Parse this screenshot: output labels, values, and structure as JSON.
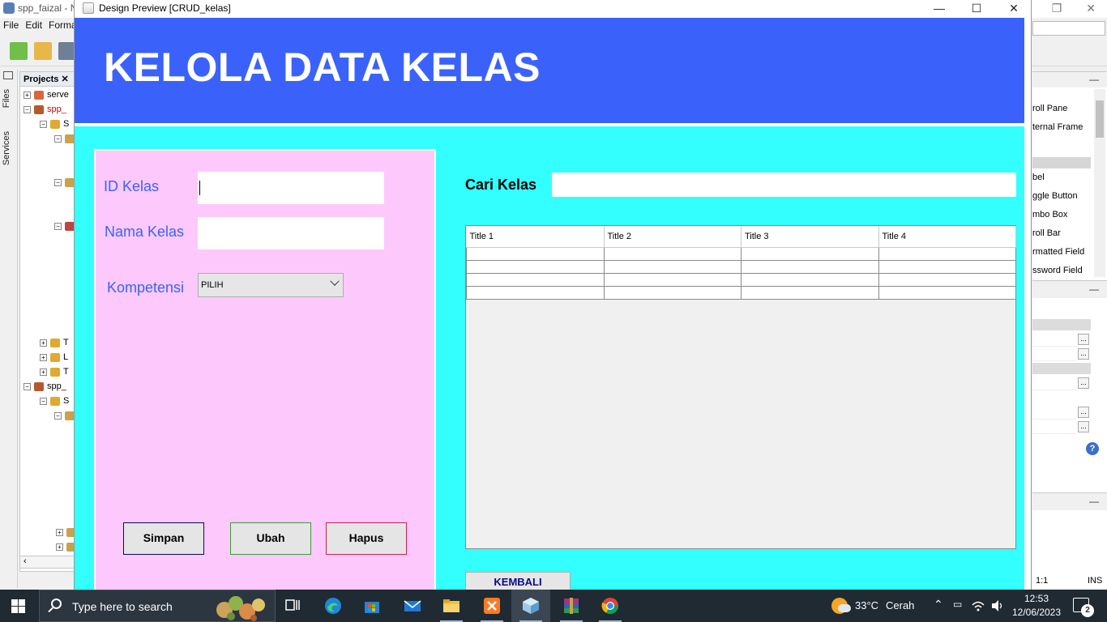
{
  "ide": {
    "title": "spp_faizal - N",
    "menu": [
      "File",
      "Edit",
      "Forma"
    ],
    "side_tabs": [
      "Files",
      "Services"
    ],
    "projects_tab": "Projects",
    "tree": [
      {
        "label": "serve"
      },
      {
        "label": "spp_"
      },
      {
        "label": "S"
      },
      {
        "label": ""
      },
      {
        "label": ""
      },
      {
        "label": ""
      },
      {
        "label": "T"
      },
      {
        "label": "L"
      },
      {
        "label": "T"
      },
      {
        "label": "spp_"
      },
      {
        "label": "S"
      },
      {
        "label": ""
      }
    ],
    "palette_items": [
      "roll Pane",
      "ternal Frame",
      "bel",
      "ggle Button",
      "mbo Box",
      "roll Bar",
      "rmatted Field",
      "ssword Field"
    ],
    "status_position": "1:1",
    "status_mode": "INS"
  },
  "window": {
    "title": "Design Preview [CRUD_kelas]"
  },
  "form": {
    "heading": "KELOLA DATA KELAS",
    "id_label": "ID Kelas",
    "id_value": "",
    "nama_label": "Nama Kelas",
    "nama_value": "",
    "kompetensi_label": "Kompetensi",
    "kompetensi_selected": "PILIH",
    "simpan": "Simpan",
    "ubah": "Ubah",
    "hapus": "Hapus",
    "cari_label": "Cari Kelas",
    "cari_value": "",
    "columns": [
      "Title 1",
      "Title 2",
      "Title 3",
      "Title 4"
    ],
    "rows": [
      [
        "",
        "",
        "",
        ""
      ],
      [
        "",
        "",
        "",
        ""
      ],
      [
        "",
        "",
        "",
        ""
      ],
      [
        "",
        "",
        "",
        ""
      ]
    ],
    "kembali": "KEMBALI"
  },
  "taskbar": {
    "search_placeholder": "Type here to search",
    "weather_temp": "33°C",
    "weather_desc": "Cerah",
    "time": "12:53",
    "date": "12/06/2023",
    "notification_count": "2"
  }
}
